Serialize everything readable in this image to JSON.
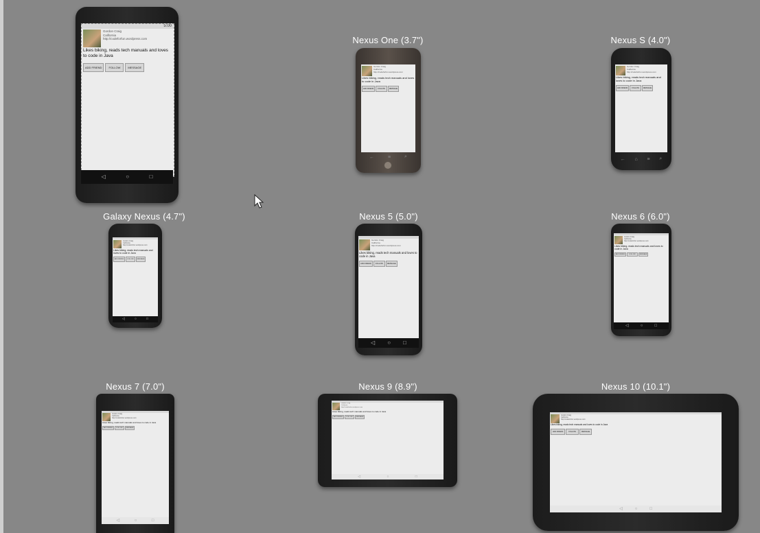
{
  "devices": [
    {
      "name": "",
      "status_time": "5:00"
    },
    {
      "name": "Nexus One (3.7\")"
    },
    {
      "name": "Nexus S (4.0\")"
    },
    {
      "name": "Galaxy Nexus (4.7\")"
    },
    {
      "name": "Nexus 5 (5.0\")"
    },
    {
      "name": "Nexus 6 (6.0\")"
    },
    {
      "name": "Nexus 7 (7.0\")"
    },
    {
      "name": "Nexus 9 (8.9\")"
    },
    {
      "name": "Nexus 10 (10.1\")"
    }
  ],
  "profile": {
    "name": "Gordon Craig",
    "location": "California",
    "url": "http://codeforfun.wordpress.com",
    "bio": "Likes biking, reads tech manuals and loves to code in Java",
    "buttons": [
      "ADD FRIEND",
      "FOLLOW",
      "MESSAGE"
    ]
  },
  "nav_icons": [
    "back-icon",
    "home-icon",
    "recents-icon"
  ]
}
